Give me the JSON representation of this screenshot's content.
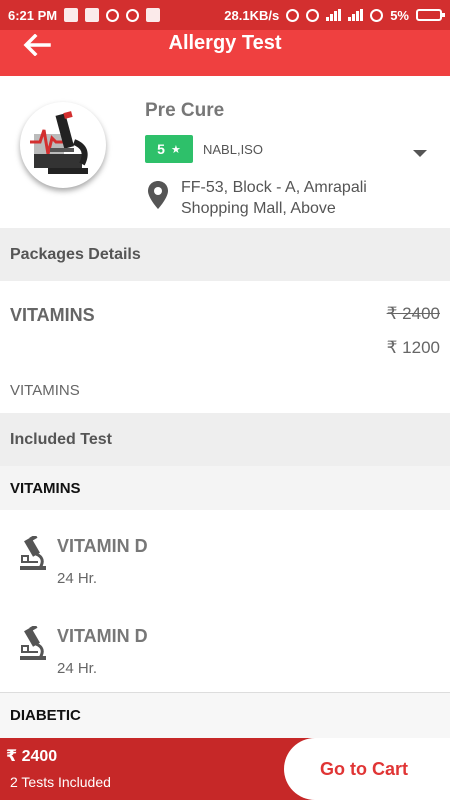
{
  "status_bar": {
    "time": "6:21 PM",
    "network_speed": "28.1KB/s",
    "battery": "5%"
  },
  "header": {
    "title": "Allergy Test",
    "back_icon": "arrow-left-icon"
  },
  "lab": {
    "name": "Pre Cure",
    "rating": "5",
    "rating_icon": "star-icon",
    "accreditation": "NABL,ISO",
    "address": "FF-53, Block - A, Amrapali Shopping Mall, Above",
    "logo_icon": "microscope-logo-icon",
    "location_icon": "location-pin-icon"
  },
  "sections": {
    "packages_details": "Packages Details",
    "included_test": "Included Test"
  },
  "package": {
    "name": "VITAMINS",
    "original_price": "₹ 2400",
    "price": "₹ 1200",
    "description": "VITAMINS"
  },
  "groups": [
    {
      "name": "VITAMINS",
      "tests": [
        {
          "name": "VITAMIN D",
          "duration": "24 Hr.",
          "icon": "microscope-icon"
        },
        {
          "name": "VITAMIN D",
          "duration": "24 Hr.",
          "icon": "microscope-icon"
        }
      ]
    },
    {
      "name": "DIABETIC",
      "tests": []
    }
  ],
  "footer": {
    "total": "₹ 2400",
    "tests_included": "2 Tests Included",
    "cart_label": "Go to Cart"
  },
  "colors": {
    "status_bar": "#d32f2f",
    "app_bar": "#ef4040",
    "rating_badge": "#2ec06a",
    "bottom_bar": "#c62828",
    "cart_text": "#e03535"
  }
}
